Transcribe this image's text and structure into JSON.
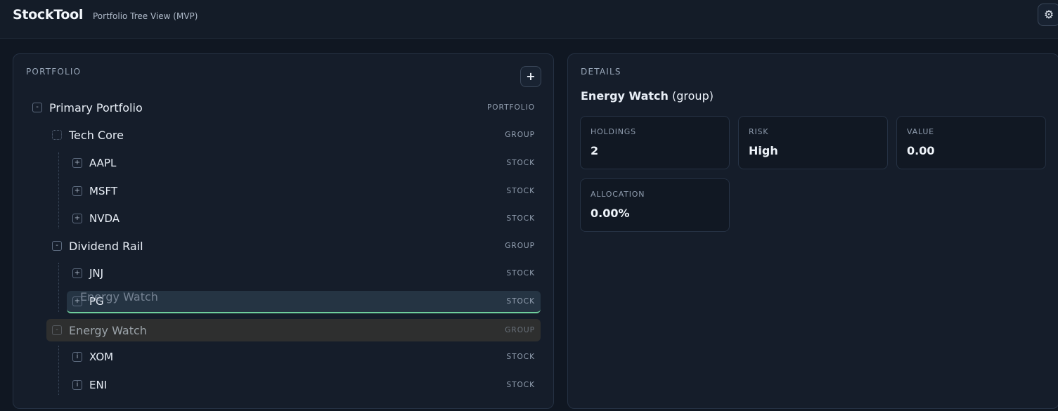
{
  "app": {
    "title": "StockTool",
    "subtitle": "Portfolio Tree View (MVP)",
    "settings_icon": "gear-icon"
  },
  "portfolio_panel": {
    "label": "PORTFOLIO",
    "add_label": "+",
    "drag_ghost": "Energy Watch",
    "rows": [
      {
        "toggle": "-",
        "name": "Primary Portfolio",
        "type": "PORTFOLIO"
      },
      {
        "toggle": "",
        "name": "Tech Core",
        "type": "GROUP"
      },
      {
        "toggle": "+",
        "name": "AAPL",
        "type": "STOCK"
      },
      {
        "toggle": "+",
        "name": "MSFT",
        "type": "STOCK"
      },
      {
        "toggle": "+",
        "name": "NVDA",
        "type": "STOCK"
      },
      {
        "toggle": "-",
        "name": "Dividend Rail",
        "type": "GROUP"
      },
      {
        "toggle": "+",
        "name": "JNJ",
        "type": "STOCK"
      },
      {
        "toggle": "+",
        "name": "PG",
        "type": "STOCK"
      },
      {
        "toggle": "-",
        "name": "Energy Watch",
        "type": "GROUP"
      },
      {
        "toggle": "i",
        "name": "XOM",
        "type": "STOCK"
      },
      {
        "toggle": "i",
        "name": "ENI",
        "type": "STOCK"
      }
    ]
  },
  "details_panel": {
    "label": "DETAILS",
    "title_name": "Energy Watch",
    "title_kind": "(group)",
    "cards": [
      {
        "label": "HOLDINGS",
        "value": "2"
      },
      {
        "label": "RISK",
        "value": "High"
      },
      {
        "label": "VALUE",
        "value": "0.00"
      },
      {
        "label": "ALLOCATION",
        "value": "0.00%"
      }
    ]
  },
  "colors": {
    "background": "#101722",
    "panel": "#151d2a",
    "drop_indicator": "#6fcf9d"
  }
}
